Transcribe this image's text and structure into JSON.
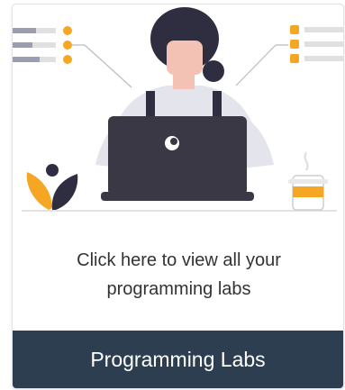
{
  "card": {
    "description": "Click here to view all your programming labs",
    "button_label": "Programming Labs"
  },
  "colors": {
    "footer_bg": "#2d3e50",
    "accent_orange": "#f5a623",
    "laptop": "#3a3845",
    "hair": "#2f2e41"
  },
  "illustration": {
    "icons": [
      "person-at-laptop-icon",
      "checklist-icon",
      "plant-icon",
      "coffee-cup-icon"
    ]
  }
}
